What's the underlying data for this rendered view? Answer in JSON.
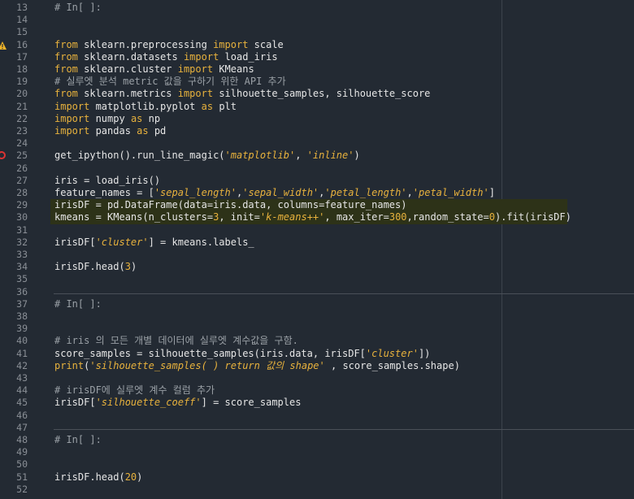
{
  "lines": [
    {
      "n": "13",
      "tokens": [
        {
          "t": "# In[ ]:",
          "c": "cm"
        }
      ]
    },
    {
      "n": "14",
      "tokens": []
    },
    {
      "n": "15",
      "tokens": []
    },
    {
      "n": "16",
      "tokens": [
        {
          "t": "from",
          "c": "kw"
        },
        {
          "t": " sklearn.preprocessing ",
          "c": ""
        },
        {
          "t": "import",
          "c": "kw"
        },
        {
          "t": " scale",
          "c": ""
        }
      ]
    },
    {
      "n": "17",
      "tokens": [
        {
          "t": "from",
          "c": "kw"
        },
        {
          "t": " sklearn.datasets ",
          "c": ""
        },
        {
          "t": "import",
          "c": "kw"
        },
        {
          "t": " load_iris",
          "c": ""
        }
      ]
    },
    {
      "n": "18",
      "tokens": [
        {
          "t": "from",
          "c": "kw"
        },
        {
          "t": " sklearn.cluster ",
          "c": ""
        },
        {
          "t": "import",
          "c": "kw"
        },
        {
          "t": " KMeans",
          "c": ""
        }
      ]
    },
    {
      "n": "19",
      "tokens": [
        {
          "t": "# 실루엣 분석 metric 값을 구하기 위한 API 추가",
          "c": "cm"
        }
      ]
    },
    {
      "n": "20",
      "tokens": [
        {
          "t": "from",
          "c": "kw"
        },
        {
          "t": " sklearn.metrics ",
          "c": ""
        },
        {
          "t": "import",
          "c": "kw"
        },
        {
          "t": " silhouette_samples, silhouette_score",
          "c": ""
        }
      ]
    },
    {
      "n": "21",
      "tokens": [
        {
          "t": "import",
          "c": "kw"
        },
        {
          "t": " matplotlib.pyplot ",
          "c": ""
        },
        {
          "t": "as",
          "c": "kw"
        },
        {
          "t": " plt",
          "c": ""
        }
      ]
    },
    {
      "n": "22",
      "tokens": [
        {
          "t": "import",
          "c": "kw"
        },
        {
          "t": " numpy ",
          "c": ""
        },
        {
          "t": "as",
          "c": "kw"
        },
        {
          "t": " np",
          "c": ""
        }
      ]
    },
    {
      "n": "23",
      "tokens": [
        {
          "t": "import",
          "c": "kw"
        },
        {
          "t": " pandas ",
          "c": ""
        },
        {
          "t": "as",
          "c": "kw"
        },
        {
          "t": " pd",
          "c": ""
        }
      ]
    },
    {
      "n": "24",
      "tokens": []
    },
    {
      "n": "25",
      "tokens": [
        {
          "t": "get_ipython().run_line_magic(",
          "c": ""
        },
        {
          "t": "'matplotlib'",
          "c": "str"
        },
        {
          "t": ", ",
          "c": ""
        },
        {
          "t": "'inline'",
          "c": "str"
        },
        {
          "t": ")",
          "c": ""
        }
      ]
    },
    {
      "n": "26",
      "tokens": []
    },
    {
      "n": "27",
      "tokens": [
        {
          "t": "iris = load_iris()",
          "c": ""
        }
      ]
    },
    {
      "n": "28",
      "tokens": [
        {
          "t": "feature_names = [",
          "c": ""
        },
        {
          "t": "'sepal_length'",
          "c": "str"
        },
        {
          "t": ",",
          "c": ""
        },
        {
          "t": "'sepal_width'",
          "c": "str"
        },
        {
          "t": ",",
          "c": ""
        },
        {
          "t": "'petal_length'",
          "c": "str"
        },
        {
          "t": ",",
          "c": ""
        },
        {
          "t": "'petal_width'",
          "c": "str"
        },
        {
          "t": "]",
          "c": ""
        }
      ]
    },
    {
      "n": "29",
      "hl": true,
      "tokens": [
        {
          "t": "irisDF = pd.DataFrame(data=iris.data, columns=feature_names)",
          "c": ""
        }
      ]
    },
    {
      "n": "30",
      "hl": true,
      "tokens": [
        {
          "t": "kmeans = KMeans(n_clusters=",
          "c": ""
        },
        {
          "t": "3",
          "c": "num"
        },
        {
          "t": ", init=",
          "c": ""
        },
        {
          "t": "'k-means++'",
          "c": "str"
        },
        {
          "t": ", max_iter=",
          "c": ""
        },
        {
          "t": "300",
          "c": "num"
        },
        {
          "t": ",random_state=",
          "c": ""
        },
        {
          "t": "0",
          "c": "num"
        },
        {
          "t": ").fit(irisDF)",
          "c": ""
        }
      ]
    },
    {
      "n": "31",
      "tokens": []
    },
    {
      "n": "32",
      "tokens": [
        {
          "t": "irisDF[",
          "c": ""
        },
        {
          "t": "'cluster'",
          "c": "str"
        },
        {
          "t": "] = kmeans.labels_",
          "c": ""
        }
      ]
    },
    {
      "n": "33",
      "tokens": []
    },
    {
      "n": "34",
      "tokens": [
        {
          "t": "irisDF.head(",
          "c": ""
        },
        {
          "t": "3",
          "c": "num"
        },
        {
          "t": ")",
          "c": ""
        }
      ]
    },
    {
      "n": "35",
      "tokens": []
    },
    {
      "n": "36",
      "tokens": []
    },
    {
      "n": "37",
      "sep": true,
      "tokens": [
        {
          "t": "# In[ ]:",
          "c": "cm"
        }
      ]
    },
    {
      "n": "38",
      "tokens": []
    },
    {
      "n": "39",
      "tokens": []
    },
    {
      "n": "40",
      "tokens": [
        {
          "t": "# iris 의 모든 개별 데이터에 실루엣 계수값을 구함.",
          "c": "cm"
        }
      ]
    },
    {
      "n": "41",
      "tokens": [
        {
          "t": "score_samples = silhouette_samples(iris.data, irisDF[",
          "c": ""
        },
        {
          "t": "'cluster'",
          "c": "str"
        },
        {
          "t": "])",
          "c": ""
        }
      ]
    },
    {
      "n": "42",
      "tokens": [
        {
          "t": "print",
          "c": "kw"
        },
        {
          "t": "(",
          "c": ""
        },
        {
          "t": "'silhouette_samples( ) return 값의 shape'",
          "c": "str"
        },
        {
          "t": " , score_samples.shape)",
          "c": ""
        }
      ]
    },
    {
      "n": "43",
      "tokens": []
    },
    {
      "n": "44",
      "tokens": [
        {
          "t": "# irisDF에 실루엣 계수 컬럼 추가",
          "c": "cm"
        }
      ]
    },
    {
      "n": "45",
      "tokens": [
        {
          "t": "irisDF[",
          "c": ""
        },
        {
          "t": "'silhouette_coeff'",
          "c": "str"
        },
        {
          "t": "] = score_samples",
          "c": ""
        }
      ]
    },
    {
      "n": "46",
      "tokens": []
    },
    {
      "n": "47",
      "tokens": []
    },
    {
      "n": "48",
      "sep": true,
      "tokens": [
        {
          "t": "# In[ ]:",
          "c": "cm"
        }
      ]
    },
    {
      "n": "49",
      "tokens": []
    },
    {
      "n": "50",
      "tokens": []
    },
    {
      "n": "51",
      "tokens": [
        {
          "t": "irisDF.head(",
          "c": ""
        },
        {
          "t": "20",
          "c": "num"
        },
        {
          "t": ")",
          "c": ""
        }
      ]
    },
    {
      "n": "52",
      "tokens": []
    }
  ],
  "markers": {
    "warning_line": "16",
    "error_line": "25"
  },
  "icons": {
    "warning": "warning-icon",
    "error": "error-breakpoint-icon"
  },
  "colors": {
    "background": "#232a33",
    "keyword": "#e8b23d",
    "comment": "#9aa0a6",
    "highlight": "#2d3218"
  }
}
